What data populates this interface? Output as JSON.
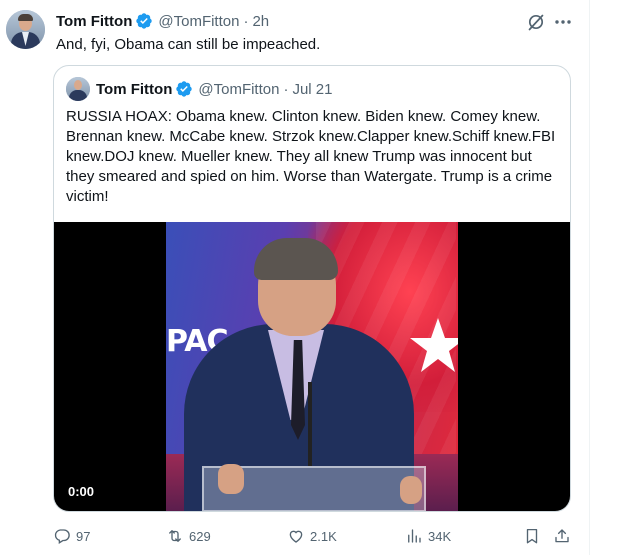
{
  "tweet": {
    "author_name": "Tom Fitton",
    "author_handle": "@TomFitton",
    "separator": "·",
    "time": "2h",
    "text": "And, fyi, Obama can still be impeached.",
    "icons": {
      "verified": "verified-badge-icon",
      "grok": "grok-icon",
      "more": "more-options-icon"
    }
  },
  "quoted_tweet": {
    "author_name": "Tom Fitton",
    "author_handle": "@TomFitton",
    "separator": "·",
    "date": "Jul 21",
    "text": "RUSSIA HOAX: Obama knew. Clinton knew. Biden knew. Comey knew. Brennan knew. McCabe knew. Strzok knew.Clapper knew.Schiff knew.FBI knew.DOJ knew. Mueller knew. They all knew Trump was innocent but they smeared and spied on him. Worse than Watergate. Trump is a crime victim!",
    "video": {
      "timestamp": "0:00",
      "backdrop_text": "PAC"
    }
  },
  "actions": {
    "replies": "97",
    "reposts": "629",
    "likes": "2.1K",
    "views": "34K"
  },
  "colors": {
    "text": "#0f1419",
    "secondary": "#536471",
    "verified": "#1d9bf0",
    "border": "#cfd9de"
  }
}
